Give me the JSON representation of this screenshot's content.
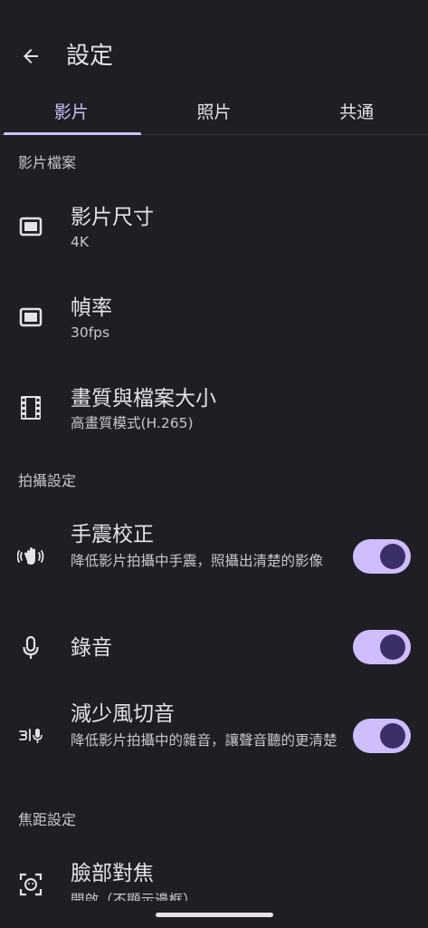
{
  "app_bar": {
    "title": "設定"
  },
  "tabs": [
    {
      "label": "影片",
      "active": true
    },
    {
      "label": "照片",
      "active": false
    },
    {
      "label": "共通",
      "active": false
    }
  ],
  "sections": {
    "video_file": "影片檔案",
    "capture": "拍攝設定",
    "focus": "焦距設定"
  },
  "settings": {
    "video_size": {
      "title": "影片尺寸",
      "value": "4K",
      "icon": "video-size-icon"
    },
    "frame_rate": {
      "title": "幀率",
      "value": "30fps",
      "icon": "frame-rate-icon"
    },
    "quality": {
      "title": "畫質與檔案大小",
      "value": "高畫質模式(H.265)",
      "icon": "film-strip-icon"
    },
    "stabilization": {
      "title": "手震校正",
      "desc": "降低影片拍攝中手震，照攝出清楚的影像",
      "enabled": true,
      "icon": "hand-shake-icon"
    },
    "audio": {
      "title": "錄音",
      "enabled": true,
      "icon": "microphone-icon"
    },
    "wind_noise": {
      "title": "減少風切音",
      "desc": "降低影片拍攝中的雜音，讓聲音聽的更清楚",
      "enabled": true,
      "icon": "wind-noise-icon"
    },
    "face_focus": {
      "title": "臉部對焦",
      "value": "開啟（不顯示邊框）",
      "icon": "face-focus-icon"
    }
  },
  "colors": {
    "background": "#1f1f23",
    "accent": "#cfbdfe",
    "toggle_thumb": "#3a2f66",
    "text_primary": "#e6e1e5",
    "text_secondary": "#c9c4cf"
  }
}
